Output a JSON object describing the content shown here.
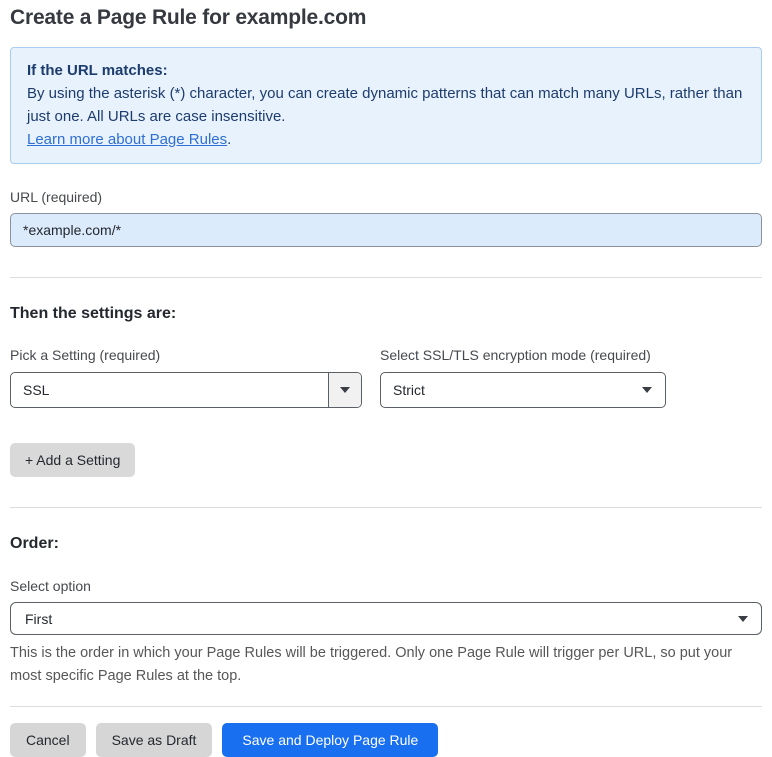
{
  "page": {
    "title": "Create a Page Rule for example.com"
  },
  "info_box": {
    "heading": "If the URL matches:",
    "body": "By using the asterisk (*) character, you can create dynamic patterns that can match many URLs, rather than just one. All URLs are case insensitive.",
    "link_label": "Learn more about Page Rules",
    "link_suffix": "."
  },
  "url_field": {
    "label": "URL (required)",
    "value": "*example.com/*"
  },
  "settings_section": {
    "heading": "Then the settings are:",
    "setting_picker": {
      "label": "Pick a Setting (required)",
      "value": "SSL"
    },
    "mode_picker": {
      "label": "Select SSL/TLS encryption mode (required)",
      "value": "Strict"
    },
    "add_setting_label": "+ Add a Setting"
  },
  "order_section": {
    "heading": "Order:",
    "select_label": "Select option",
    "value": "First",
    "help_text": "This is the order in which your Page Rules will be triggered. Only one Page Rule will trigger per URL, so put your most specific Page Rules at the top."
  },
  "footer": {
    "cancel_label": "Cancel",
    "save_draft_label": "Save as Draft",
    "save_deploy_label": "Save and Deploy Page Rule"
  },
  "colors": {
    "accent_blue": "#186fef",
    "info_box_bg": "#e8f2fc",
    "info_box_border": "#a9cdef",
    "info_text": "#1d3c6e",
    "link_blue": "#2f6fd2",
    "url_input_bg": "#dcebfc",
    "neutral_button_bg": "#d6d6d6"
  },
  "icons": {
    "caret_down": "caret-down-icon"
  }
}
